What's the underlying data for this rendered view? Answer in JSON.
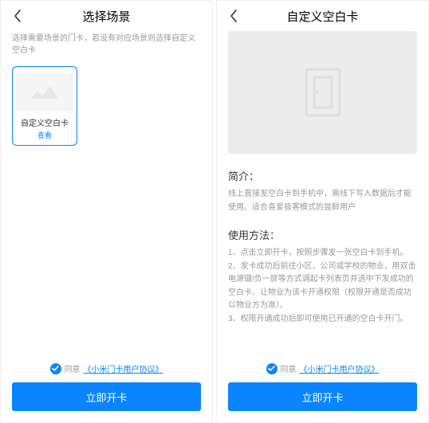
{
  "left": {
    "title": "选择场景",
    "subtitle": "选择需要场景的门卡，若没有对应场景则选择自定义空白卡",
    "card": {
      "title": "自定义空白卡",
      "link": "查看"
    },
    "agreement": {
      "prefix": "同意",
      "link": "《小米门卡用户协议》"
    },
    "button": "立即开卡"
  },
  "right": {
    "title": "自定义空白卡",
    "intro": {
      "heading": "简介：",
      "body": "线上直接发空白卡到手机中，需线下写入数据后才能使用。适合喜爱极客模式的尝鲜用户"
    },
    "usage": {
      "heading": "使用方法：",
      "body": "1、点击立即开卡，按照步骤发一张空白卡到手机。\n2、发卡成功后前往小区、公司或学校的物业，用双击电源键/负一屏等方式调起卡列表页并选中下发成功的空白卡。让物业为该卡开通权限（权限开通是否成功以物业方为准）。\n3、权限开通成功后即可使用已开通的空白卡开门。"
    },
    "agreement": {
      "prefix": "同意",
      "link": "《小米门卡用户协议》"
    },
    "button": "立即开卡"
  }
}
